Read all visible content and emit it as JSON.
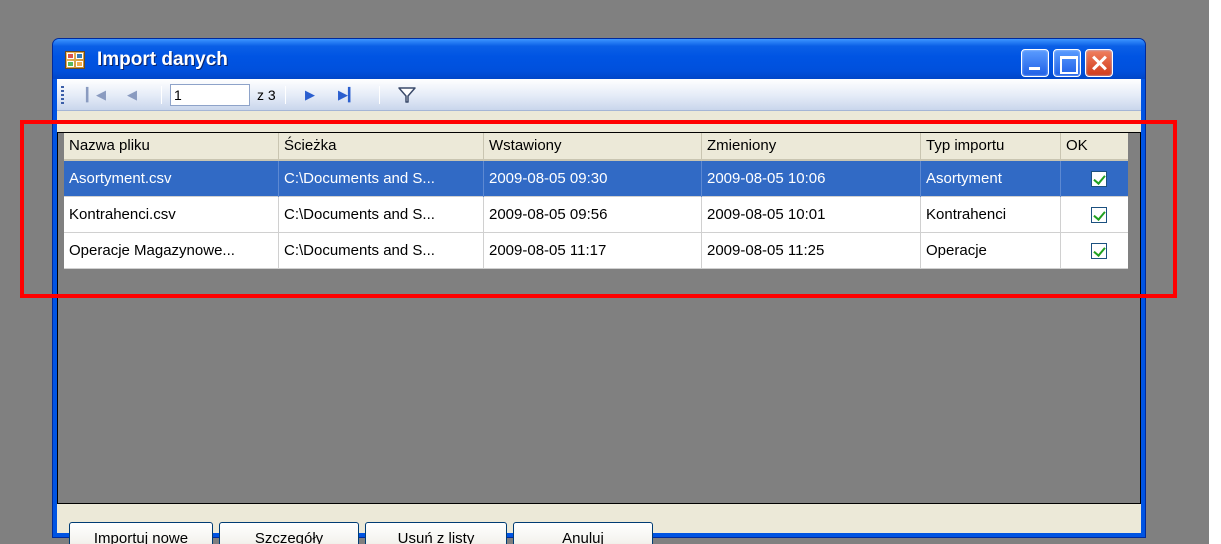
{
  "window": {
    "title": "Import danych",
    "controls": [
      "minimize",
      "maximize",
      "close"
    ]
  },
  "navigator": {
    "current_page": "1",
    "page_count_label": "z 3",
    "icons": [
      "move-first-icon",
      "move-previous-icon",
      "move-next-icon",
      "move-last-icon",
      "filter-icon"
    ]
  },
  "grid": {
    "columns": [
      "Nazwa pliku",
      "Ścieżka",
      "Wstawiony",
      "Zmieniony",
      "Typ importu",
      "OK"
    ],
    "rows": [
      {
        "file": "Asortyment.csv",
        "path": "C:\\Documents and S...",
        "inserted": "2009-08-05 09:30",
        "modified": "2009-08-05 10:06",
        "type": "Asortyment",
        "ok": true,
        "selected": true
      },
      {
        "file": "Kontrahenci.csv",
        "path": "C:\\Documents and S...",
        "inserted": "2009-08-05 09:56",
        "modified": "2009-08-05 10:01",
        "type": "Kontrahenci",
        "ok": true,
        "selected": false
      },
      {
        "file": "Operacje Magazynowe...",
        "path": "C:\\Documents and S...",
        "inserted": "2009-08-05 11:17",
        "modified": "2009-08-05 11:25",
        "type": "Operacje",
        "ok": true,
        "selected": false
      }
    ]
  },
  "buttons": {
    "import_new": "Importuj nowe",
    "details": "Szczegóły",
    "remove": "Usuń z listy",
    "cancel": "Anuluj"
  },
  "colors": {
    "selection": "#316ac5",
    "title_bar": "#0054e3",
    "annotation": "#ff0000",
    "checkmark": "#21a121"
  }
}
